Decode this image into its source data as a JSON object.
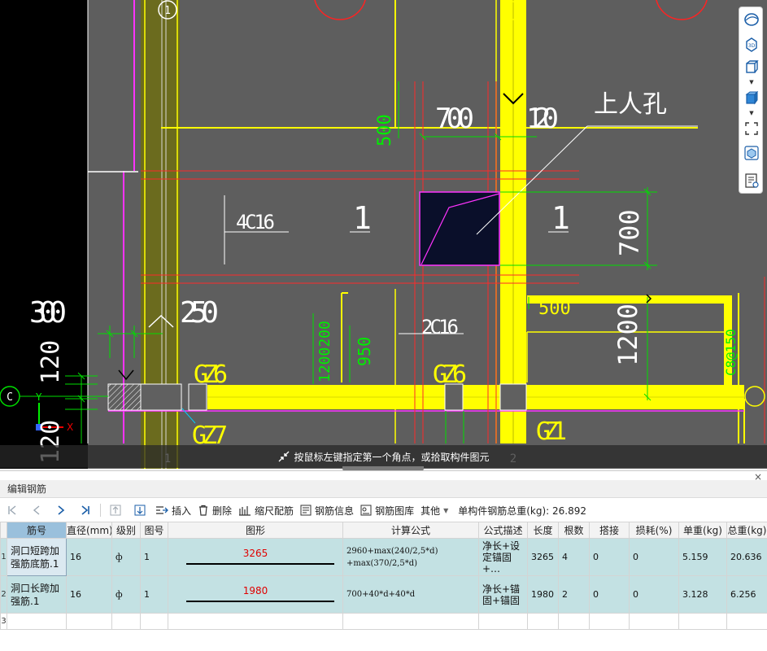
{
  "cad": {
    "labels": {
      "circle_1_top": "1",
      "circle_1_bottom": "1",
      "circle_2_bottom": "2",
      "circle_c": "C",
      "dim_700_top": "700",
      "dim_120_top": "120",
      "dim_500_left": "500",
      "hole_label": "上人孔",
      "rebar_4c16": "4C16",
      "slab_1_left": "1",
      "slab_1_right": "1",
      "dim_700_right": "700",
      "dim_300": "300",
      "dim_250": "250",
      "dim_120_left": "120",
      "dim_120_left_b": "120",
      "dim_500_mid": "500",
      "rebar_2c16": "2C16",
      "dim_1200": "1200",
      "dim_950": "950",
      "text_1200_200": "1200200",
      "text_right_vert": "C8@150",
      "gz6_left": "GZ6",
      "gz6_mid": "GZ6",
      "gz7": "GZ7",
      "gz1": "GZ1",
      "axis_x": "X",
      "axis_y": "Y"
    }
  },
  "view_toolbar": {
    "icons": [
      "sphere-icon",
      "3d-view-icon",
      "cube-outline-icon",
      "cube-solid-icon",
      "fullscreen-icon",
      "cube-settings-icon",
      "properties-icon"
    ]
  },
  "prompt": {
    "text": "按鼠标左键指定第一个角点，或拾取构件图元"
  },
  "editor": {
    "title": "编辑钢筋",
    "close": "×",
    "toolbar": {
      "insert": "插入",
      "delete": "删除",
      "scale_rebar": "缩尺配筋",
      "rebar_info": "钢筋信息",
      "rebar_library": "钢筋图库",
      "other": "其他",
      "total_weight": "单构件钢筋总重(kg): 26.892"
    },
    "columns": [
      "筋号",
      "直径(mm)",
      "级别",
      "图号",
      "图形",
      "计算公式",
      "公式描述",
      "长度",
      "根数",
      "搭接",
      "损耗(%)",
      "单重(kg)",
      "总重(kg)"
    ],
    "rows": [
      {
        "num": "1",
        "name": "洞口短跨加强筋底筋.1",
        "diameter": "16",
        "grade": "ф",
        "figure_no": "1",
        "shape_value": "3265",
        "formula_l1": "2960+max(240/2,5*d)",
        "formula_l2": "+max(370/2,5*d)",
        "desc": "净长+设定锚固+…",
        "length": "3265",
        "count": "4",
        "lap": "0",
        "loss": "0",
        "unit_weight": "5.159",
        "total_weight": "20.636"
      },
      {
        "num": "2",
        "name": "洞口长跨加强筋.1",
        "diameter": "16",
        "grade": "ф",
        "figure_no": "1",
        "shape_value": "1980",
        "formula_l1": "700+40*d+40*d",
        "formula_l2": "",
        "desc": "净长+锚固+锚固",
        "length": "1980",
        "count": "2",
        "lap": "0",
        "loss": "0",
        "unit_weight": "3.128",
        "total_weight": "6.256"
      }
    ],
    "empty_row_num": "3"
  }
}
